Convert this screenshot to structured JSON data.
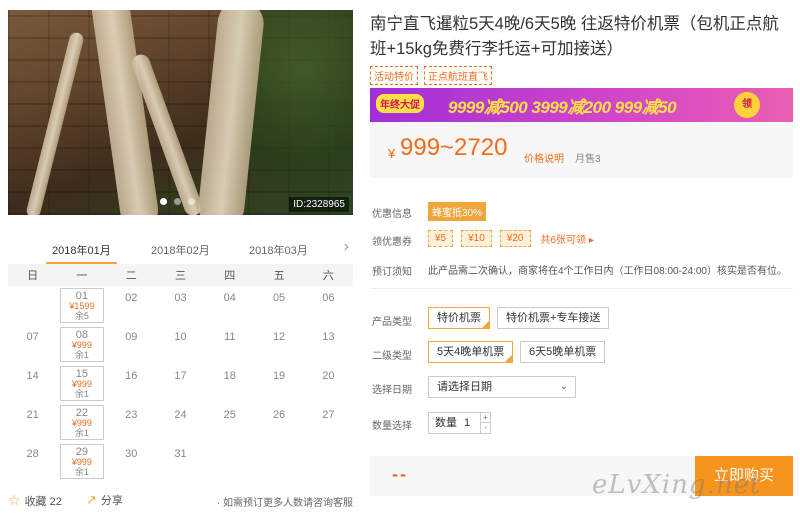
{
  "product": {
    "image_id": "ID:2328965",
    "title": "南宁直飞暹粒5天4晚/6天5晚 往返特价机票（包机正点航班+15kg免费行李托运+可加接送）",
    "tags": [
      "活动特价",
      "正点航班直飞"
    ]
  },
  "promo": {
    "badge": "年终大促",
    "text": "9999减500  3999减200  999减50",
    "coin": "领"
  },
  "price": {
    "yen": "¥",
    "range": "999~2720",
    "note": "价格说明",
    "sold": "月售3"
  },
  "info": {
    "discount_label": "优惠信息",
    "discount_value": "蜂蜜抵30%",
    "coupon_label": "领优惠券",
    "coupons": [
      "¥5",
      "¥10",
      "¥20"
    ],
    "coupon_more": "共6张可领 ▸",
    "notice_label": "预订须知",
    "notice_text": "此产品需二次确认，商家将在4个工作日内（工作日08:00-24:00）核实是否有位。"
  },
  "options": {
    "type_label": "产品类型",
    "types": [
      "特价机票",
      "特价机票+专车接送"
    ],
    "sub_label": "二级类型",
    "subs": [
      "5天4晚单机票",
      "6天5晚单机票"
    ],
    "date_label": "选择日期",
    "date_placeholder": "请选择日期",
    "qty_label": "数量选择",
    "qty_text": "数量",
    "qty_value": "1",
    "qty_up": "+",
    "qty_down": "-"
  },
  "buy": {
    "total": "--",
    "button": "立即购买"
  },
  "watermark": "eLvXing.net",
  "calendar": {
    "months": [
      "2018年01月",
      "2018年02月",
      "2018年03月"
    ],
    "next": "›",
    "weekdays": [
      "日",
      "一",
      "二",
      "三",
      "四",
      "五",
      "六"
    ],
    "cells": [
      {
        "d": ""
      },
      {
        "d": "01",
        "p": "¥1599",
        "r": "余5"
      },
      {
        "d": "02"
      },
      {
        "d": "03"
      },
      {
        "d": "04"
      },
      {
        "d": "05"
      },
      {
        "d": "06"
      },
      {
        "d": "07"
      },
      {
        "d": "08",
        "p": "¥999",
        "r": "余1"
      },
      {
        "d": "09"
      },
      {
        "d": "10"
      },
      {
        "d": "11"
      },
      {
        "d": "12"
      },
      {
        "d": "13"
      },
      {
        "d": "14"
      },
      {
        "d": "15",
        "p": "¥999",
        "r": "余1"
      },
      {
        "d": "16"
      },
      {
        "d": "17"
      },
      {
        "d": "18"
      },
      {
        "d": "19"
      },
      {
        "d": "20"
      },
      {
        "d": "21"
      },
      {
        "d": "22",
        "p": "¥999",
        "r": "余1"
      },
      {
        "d": "23"
      },
      {
        "d": "24"
      },
      {
        "d": "25"
      },
      {
        "d": "26"
      },
      {
        "d": "27"
      },
      {
        "d": "28"
      },
      {
        "d": "29",
        "p": "¥999",
        "r": "余1"
      },
      {
        "d": "30"
      },
      {
        "d": "31"
      },
      {
        "d": ""
      },
      {
        "d": ""
      },
      {
        "d": ""
      }
    ]
  },
  "social": {
    "fav": "收藏 22",
    "share": "分享",
    "tip": "· 如需预订更多人数请咨询客服"
  }
}
